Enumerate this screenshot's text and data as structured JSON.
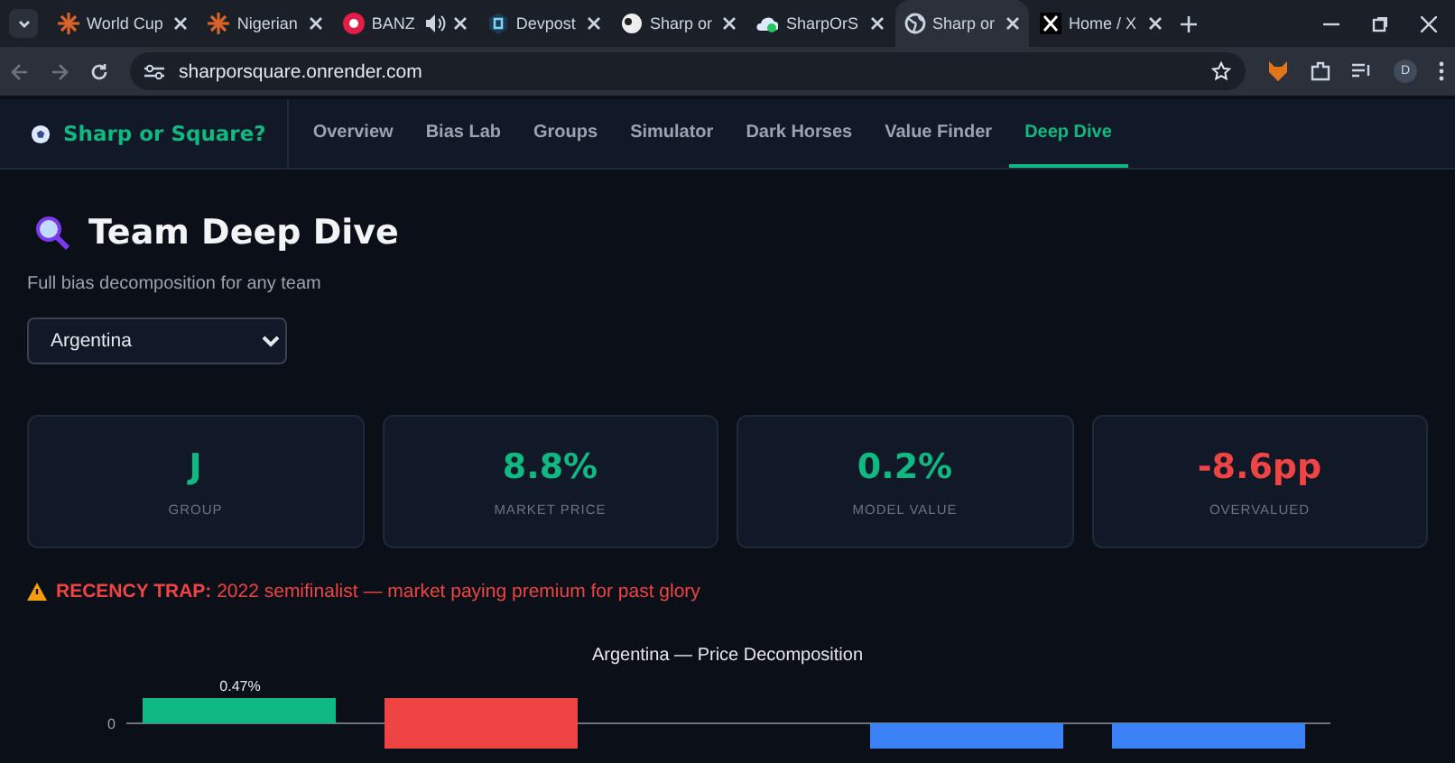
{
  "browser": {
    "tabs": [
      {
        "title": "World Cup",
        "kind": "burst",
        "selected": false,
        "audio": false
      },
      {
        "title": "Nigerian",
        "kind": "burst",
        "selected": false,
        "audio": false
      },
      {
        "title": "BANZ",
        "kind": "record",
        "selected": false,
        "audio": true
      },
      {
        "title": "Devpost",
        "kind": "hex",
        "selected": false,
        "audio": false
      },
      {
        "title": "Sharp or",
        "kind": "ball",
        "selected": false,
        "audio": false
      },
      {
        "title": "SharpOrS",
        "kind": "cloud",
        "selected": false,
        "audio": false
      },
      {
        "title": "Sharp or",
        "kind": "globe",
        "selected": true,
        "audio": false
      },
      {
        "title": "Home / X",
        "kind": "x",
        "selected": false,
        "audio": false
      }
    ],
    "url": "sharporsquare.onrender.com",
    "profile": "D"
  },
  "app": {
    "brand": "Sharp or Square?",
    "nav": [
      {
        "label": "Overview",
        "selected": false
      },
      {
        "label": "Bias Lab",
        "selected": false
      },
      {
        "label": "Groups",
        "selected": false
      },
      {
        "label": "Simulator",
        "selected": false
      },
      {
        "label": "Dark Horses",
        "selected": false
      },
      {
        "label": "Value Finder",
        "selected": false
      },
      {
        "label": "Deep Dive",
        "selected": true
      }
    ]
  },
  "page": {
    "title": "Team Deep Dive",
    "subtitle": "Full bias decomposition for any team",
    "team_select": {
      "value": "Argentina"
    },
    "stats": [
      {
        "value": "J",
        "label": "GROUP",
        "color": "#10b981"
      },
      {
        "value": "8.8%",
        "label": "MARKET PRICE",
        "color": "#10b981"
      },
      {
        "value": "0.2%",
        "label": "MODEL VALUE",
        "color": "#10b981"
      },
      {
        "value": "-8.6pp",
        "label": "OVERVALUED",
        "color": "#ef4444"
      }
    ],
    "alert": {
      "label": "RECENCY TRAP:",
      "text": "2022 semifinalist — market paying premium for past glory"
    },
    "chart": {
      "title": "Argentina — Price Decomposition",
      "bar_label": "0.47%",
      "tick": "0"
    }
  }
}
